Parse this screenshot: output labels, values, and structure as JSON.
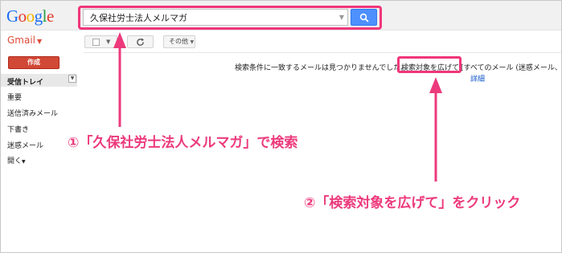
{
  "logo": {
    "text": "Google",
    "letters": [
      "G",
      "o",
      "o",
      "g",
      "l",
      "e"
    ],
    "letter_colors": [
      "#1a6ef5",
      "#e33b2e",
      "#f5b400",
      "#1a6ef5",
      "#2a9e48",
      "#e33b2e"
    ]
  },
  "search": {
    "query": "久保社労士法人メルマガ",
    "button_icon": "search-icon"
  },
  "toolbar": {
    "gmail_label": "Gmail",
    "select_icon": "checkbox-icon",
    "refresh_icon": "refresh-icon",
    "more_label": "その他"
  },
  "sidebar": {
    "compose_label": "作成",
    "items": [
      {
        "label": "受信トレイ"
      },
      {
        "label": "重要"
      },
      {
        "label": "送信済みメール"
      },
      {
        "label": "下書き"
      },
      {
        "label": "迷惑メール"
      },
      {
        "label": "開く"
      }
    ]
  },
  "results": {
    "message": "検索条件に一致するメールは見つかりませんでした。",
    "expand_link": "検索対象を広げて",
    "message_tail": "[すべてのメール (迷惑メール、",
    "detail_link": "詳細"
  },
  "annotations": {
    "step1": "①「久保社労士法人メルマガ」で検索",
    "step2": "②「検索対象を広げて」をクリック",
    "color": "#ec3a7c"
  }
}
